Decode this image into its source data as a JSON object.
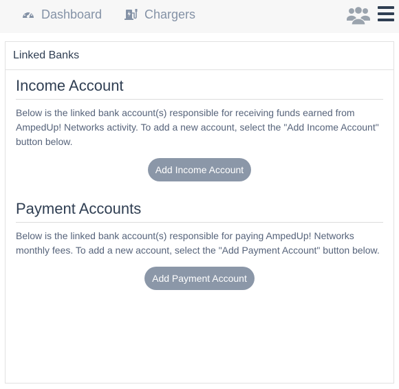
{
  "nav": {
    "dashboard_label": "Dashboard",
    "chargers_label": "Chargers",
    "dashboard_icon": "gauge-icon",
    "chargers_icon": "ev-charger-icon",
    "users_icon": "users-icon",
    "menu_icon": "hamburger-menu-icon"
  },
  "card": {
    "header": "Linked Banks"
  },
  "income": {
    "title": "Income Account",
    "description": "Below is the linked bank account(s) responsible for receiving funds earned from AmpedUp! Networks activity. To add a new account, select the \"Add Income Account\" button below.",
    "button_label": "Add Income Account"
  },
  "payment": {
    "title": "Payment Accounts",
    "description": "Below is the linked bank account(s) responsible for paying AmpedUp! Networks monthly fees. To add a new account, select the \"Add Payment Account\" button below.",
    "button_label": "Add Payment Account"
  },
  "colors": {
    "nav_text": "#8492a6",
    "heading": "#2f3e52",
    "button_bg": "#8b97a8"
  }
}
